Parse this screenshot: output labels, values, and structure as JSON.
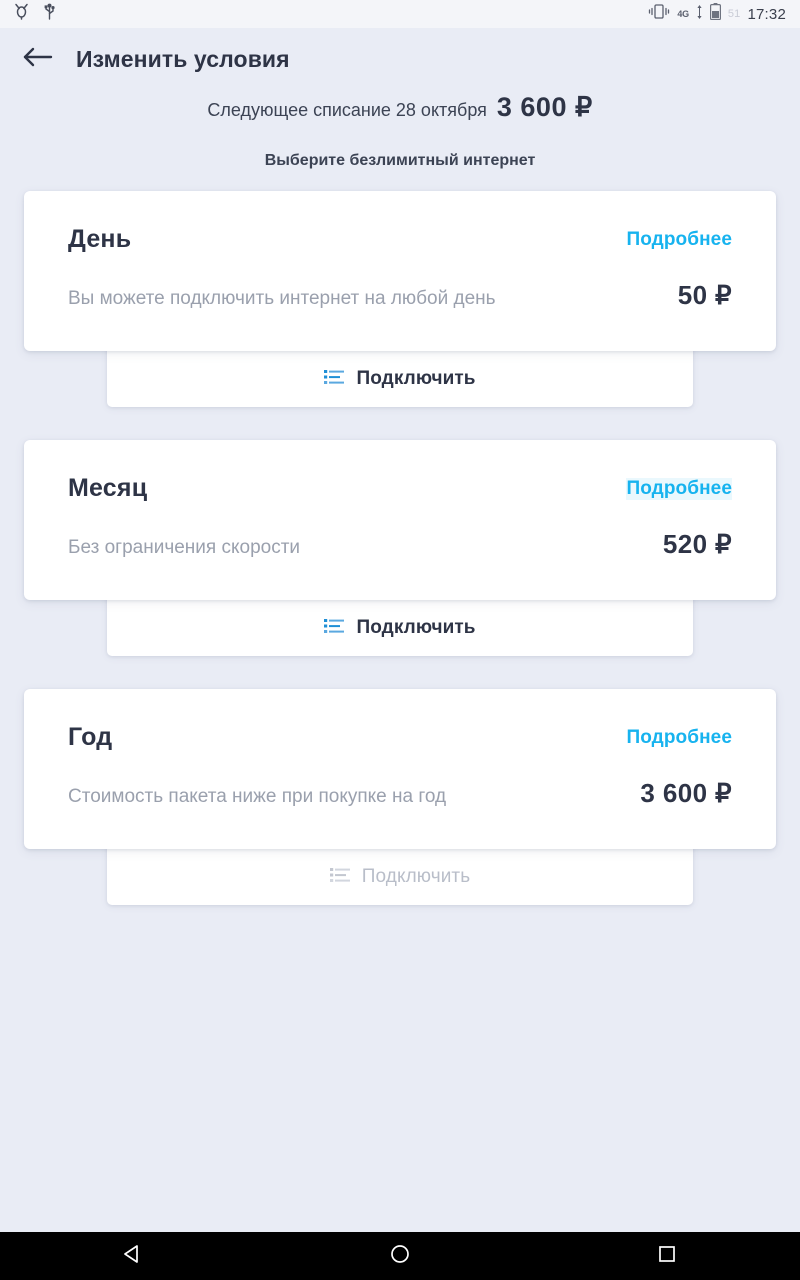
{
  "statusbar": {
    "left_icons": [
      "debug-icon",
      "usb-icon"
    ],
    "vibrate_icon": "vibrate-icon",
    "network": "4G",
    "data_transfer_icon": "data-transfer-icon",
    "battery_icon": "battery-icon",
    "battery_percent": "51",
    "time": "17:32"
  },
  "header": {
    "back_icon": "back-arrow-icon",
    "title": "Изменить условия"
  },
  "next_charge": {
    "label": "Следующее списание 28 октября",
    "amount": "3 600 ₽"
  },
  "section": {
    "title": "Выберите безлимитный интернет"
  },
  "plans": [
    {
      "name": "День",
      "more_label": "Подробнее",
      "more_highlighted": false,
      "description": "Вы можете подключить интернет на любой день",
      "price": "50 ₽",
      "connect_label": "Подключить",
      "connect_icon": "list-lines-icon",
      "connect_disabled": false
    },
    {
      "name": "Месяц",
      "more_label": "Подробнее",
      "more_highlighted": true,
      "description": "Без ограничения скорости",
      "price": "520 ₽",
      "connect_label": "Подключить",
      "connect_icon": "list-lines-icon",
      "connect_disabled": false
    },
    {
      "name": "Год",
      "more_label": "Подробнее",
      "more_highlighted": false,
      "description": "Стоимость пакета ниже при покупке на год",
      "price": "3 600 ₽",
      "connect_label": "Подключить",
      "connect_icon": "list-lines-icon",
      "connect_disabled": true
    }
  ],
  "navbar": {
    "back": "nav-back-icon",
    "home": "nav-home-icon",
    "recents": "nav-recents-icon"
  },
  "colors": {
    "background": "#e9ecf5",
    "card": "#ffffff",
    "accent_link": "#17b3ef",
    "text_primary": "#2e3446",
    "text_muted": "#9aa0ad",
    "disabled": "#b9bec9"
  }
}
